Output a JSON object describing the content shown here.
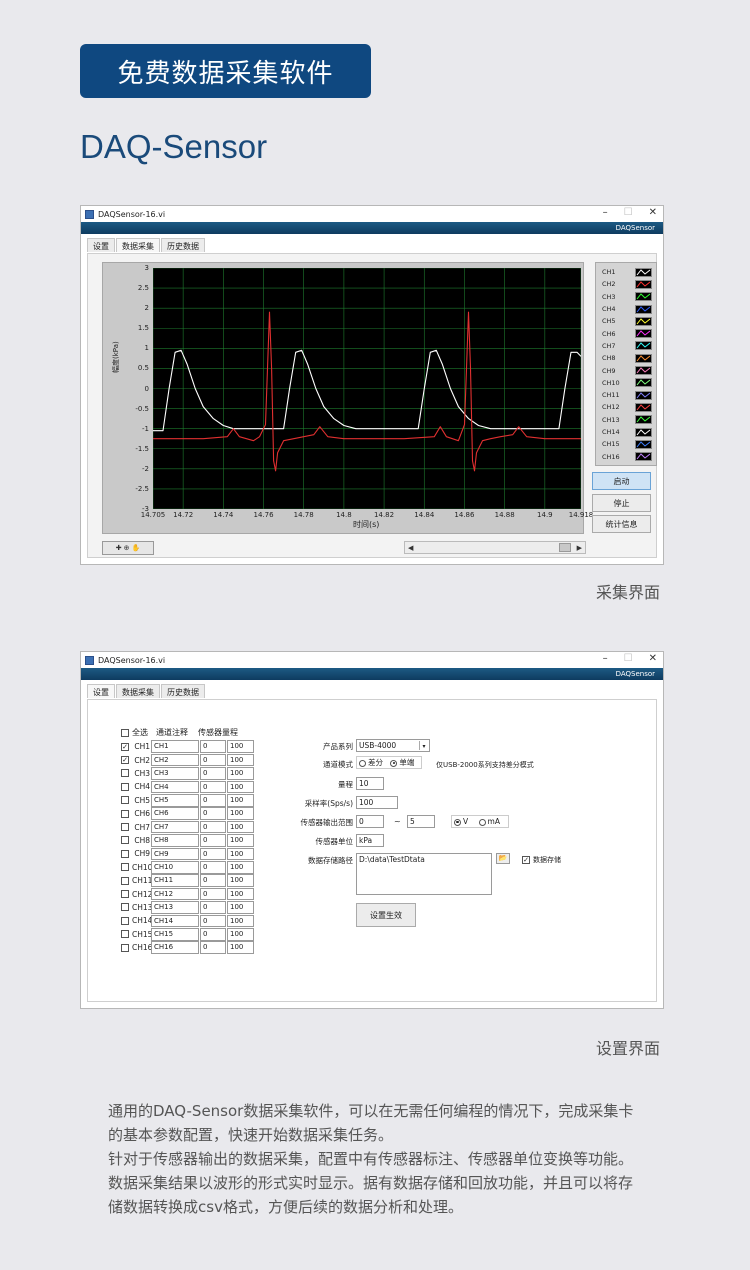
{
  "banner": "免费数据采集软件",
  "subtitle": "DAQ-Sensor",
  "window1": {
    "title": "DAQSensor-16.vi",
    "app_label": "DAQSensor",
    "controls": [
      "–",
      "☐",
      "✕"
    ],
    "tabs": [
      "设置",
      "数据采集",
      "历史数据"
    ],
    "active_tab": 1,
    "chart": {
      "ylabel": "幅度(kPa)",
      "xlabel": "时间(s)",
      "yticks": [
        "3",
        "2.5",
        "2",
        "1.5",
        "1",
        "0.5",
        "0",
        "-0.5",
        "-1",
        "-1.5",
        "-2",
        "-2.5",
        "-3"
      ],
      "xticks": [
        "14.705",
        "14.72",
        "14.74",
        "14.76",
        "14.78",
        "14.8",
        "14.82",
        "14.84",
        "14.86",
        "14.88",
        "14.9",
        "14.918"
      ]
    },
    "legend": [
      "CH1",
      "CH2",
      "CH3",
      "CH4",
      "CH5",
      "CH6",
      "CH7",
      "CH8",
      "CH9",
      "CH10",
      "CH11",
      "CH12",
      "CH13",
      "CH14",
      "CH15",
      "CH16"
    ],
    "legend_colors": [
      "#ffffff",
      "#ff3030",
      "#30ff30",
      "#3060ff",
      "#ffff30",
      "#ff30ff",
      "#30ffff",
      "#ff9030",
      "#ff80c0",
      "#80ff80",
      "#8080ff",
      "#ff4040",
      "#40ff40",
      "#ffffff",
      "#4080ff",
      "#c080ff"
    ],
    "buttons": [
      "启动",
      "停止",
      "统计信息"
    ]
  },
  "chart_data": {
    "type": "line",
    "xlabel": "时间(s)",
    "ylabel": "幅度(kPa)",
    "xlim": [
      14.705,
      14.918
    ],
    "ylim": [
      -3,
      3
    ],
    "grid": true,
    "series": [
      {
        "name": "CH1",
        "color": "#ffffff",
        "x": [
          14.705,
          14.71,
          14.713,
          14.716,
          14.719,
          14.722,
          14.726,
          14.73,
          14.735,
          14.74,
          14.745,
          14.77,
          14.773,
          14.776,
          14.779,
          14.782,
          14.786,
          14.79,
          14.795,
          14.8,
          14.806,
          14.837,
          14.84,
          14.843,
          14.846,
          14.849,
          14.853,
          14.857,
          14.862,
          14.867,
          14.873,
          14.907,
          14.91,
          14.913,
          14.916,
          14.918
        ],
        "y": [
          -1.05,
          -1.05,
          0.0,
          0.9,
          0.95,
          0.6,
          0.0,
          -0.45,
          -0.75,
          -0.92,
          -1.0,
          -1.0,
          0.0,
          0.9,
          0.95,
          0.6,
          0.0,
          -0.45,
          -0.75,
          -0.92,
          -1.0,
          -1.0,
          0.0,
          0.9,
          0.95,
          0.6,
          0.0,
          -0.45,
          -0.75,
          -0.92,
          -1.0,
          -1.0,
          0.0,
          0.9,
          0.9,
          0.8
        ]
      },
      {
        "name": "CH2",
        "color": "#e03030",
        "x": [
          14.705,
          14.73,
          14.742,
          14.745,
          14.748,
          14.755,
          14.758,
          14.761,
          14.762,
          14.763,
          14.764,
          14.765,
          14.766,
          14.767,
          14.77,
          14.775,
          14.78,
          14.785,
          14.788,
          14.792,
          14.8,
          14.83,
          14.845,
          14.848,
          14.851,
          14.857,
          14.86,
          14.861,
          14.862,
          14.863,
          14.864,
          14.865,
          14.866,
          14.869,
          14.873,
          14.878,
          14.884,
          14.887,
          14.891,
          14.9,
          14.918
        ],
        "y": [
          -1.25,
          -1.25,
          -1.2,
          -1.0,
          -1.2,
          -1.3,
          -1.2,
          -0.9,
          0.5,
          1.9,
          0.5,
          -1.8,
          -2.05,
          -1.6,
          -1.3,
          -1.25,
          -1.2,
          -1.15,
          -0.95,
          -1.2,
          -1.25,
          -1.25,
          -1.2,
          -0.95,
          -1.2,
          -1.3,
          -0.9,
          0.5,
          1.9,
          0.5,
          -1.8,
          -2.05,
          -1.6,
          -1.3,
          -1.25,
          -1.2,
          -1.15,
          -0.95,
          -1.2,
          -1.25,
          -1.25
        ]
      }
    ]
  },
  "window2": {
    "title": "DAQSensor-16.vi",
    "app_label": "DAQSensor",
    "controls": [
      "–",
      "☐",
      "✕"
    ],
    "tabs": [
      "设置",
      "数据采集",
      "历史数据"
    ],
    "active_tab": 0,
    "headers": {
      "select_all": "全选",
      "note": "通道注释",
      "range": "传感器量程"
    },
    "channels": [
      {
        "label": "CH1",
        "note": "CH1",
        "min": "0",
        "max": "100",
        "checked": true
      },
      {
        "label": "CH2",
        "note": "CH2",
        "min": "0",
        "max": "100",
        "checked": true
      },
      {
        "label": "CH3",
        "note": "CH3",
        "min": "0",
        "max": "100",
        "checked": false
      },
      {
        "label": "CH4",
        "note": "CH4",
        "min": "0",
        "max": "100",
        "checked": false
      },
      {
        "label": "CH5",
        "note": "CH5",
        "min": "0",
        "max": "100",
        "checked": false
      },
      {
        "label": "CH6",
        "note": "CH6",
        "min": "0",
        "max": "100",
        "checked": false
      },
      {
        "label": "CH7",
        "note": "CH7",
        "min": "0",
        "max": "100",
        "checked": false
      },
      {
        "label": "CH8",
        "note": "CH8",
        "min": "0",
        "max": "100",
        "checked": false
      },
      {
        "label": "CH9",
        "note": "CH9",
        "min": "0",
        "max": "100",
        "checked": false
      },
      {
        "label": "CH10",
        "note": "CH10",
        "min": "0",
        "max": "100",
        "checked": false
      },
      {
        "label": "CH11",
        "note": "CH11",
        "min": "0",
        "max": "100",
        "checked": false
      },
      {
        "label": "CH12",
        "note": "CH12",
        "min": "0",
        "max": "100",
        "checked": false
      },
      {
        "label": "CH13",
        "note": "CH13",
        "min": "0",
        "max": "100",
        "checked": false
      },
      {
        "label": "CH14",
        "note": "CH14",
        "min": "0",
        "max": "100",
        "checked": false
      },
      {
        "label": "CH15",
        "note": "CH15",
        "min": "0",
        "max": "100",
        "checked": false
      },
      {
        "label": "CH16",
        "note": "CH16",
        "min": "0",
        "max": "100",
        "checked": false
      }
    ],
    "form": {
      "product_label": "产品系列",
      "product_value": "USB-4000",
      "mode_label": "通道模式",
      "mode_diff": "差分",
      "mode_single": "单端",
      "mode_note": "仅USB-2000系列支持差分模式",
      "range_label": "量程",
      "range_value": "10",
      "rate_label": "采样率(Sps/s)",
      "rate_value": "100",
      "out_label": "传感器输出范围",
      "out_min": "0",
      "out_sep": "~",
      "out_max": "5",
      "unit_v": "V",
      "unit_ma": "mA",
      "unit_label": "传感器单位",
      "unit_value": "kPa",
      "path_label": "数据存储路径",
      "path_value": "D:\\data\\TestDtata",
      "store_label": "数据存储",
      "apply_button": "设置生效"
    }
  },
  "captions": {
    "acquire": "采集界面",
    "settings": "设置界面"
  },
  "description": [
    "通用的DAQ-Sensor数据采集软件，可以在无需任何编程的情况下，完成采集卡的基本参数配置，快速开始数据采集任务。",
    "针对于传感器输出的数据采集，配置中有传感器标注、传感器单位变换等功能。",
    "数据采集结果以波形的形式实时显示。据有数据存储和回放功能，并且可以将存储数据转换成csv格式，方便后续的数据分析和处理。"
  ]
}
